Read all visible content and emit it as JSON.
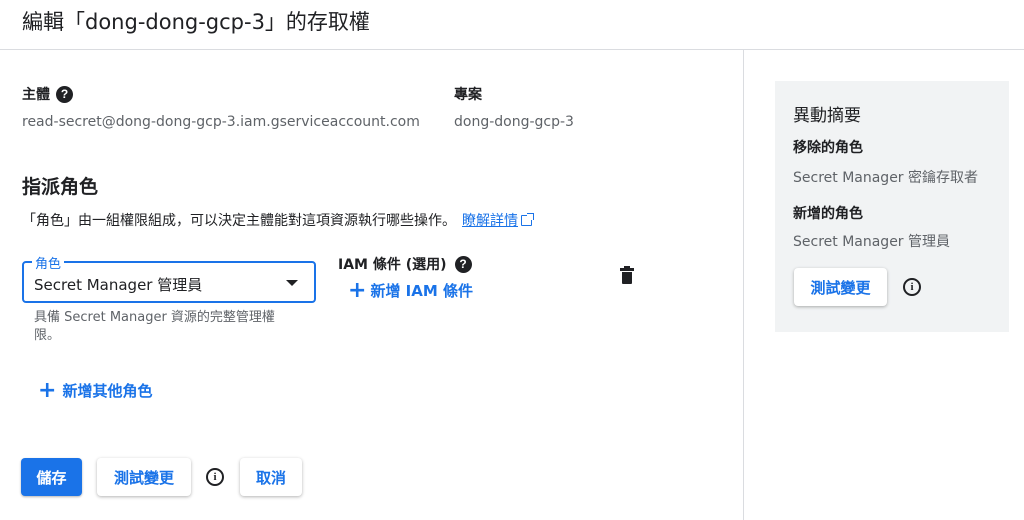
{
  "header": {
    "title": "編輯「dong-dong-gcp-3」的存取權"
  },
  "principal": {
    "label": "主體",
    "help_icon": "question-mark-circle",
    "value": "read-secret@dong-dong-gcp-3.iam.gserviceaccount.com"
  },
  "project": {
    "label": "專案",
    "value": "dong-dong-gcp-3"
  },
  "assign_roles": {
    "title": "指派角色",
    "description": "「角色」由一組權限組成，可以決定主體能對這項資源執行哪些操作。",
    "learn_more": "瞭解詳情",
    "role_field": {
      "label": "角色",
      "value": "Secret Manager 管理員",
      "hint": "具備 Secret Manager 資源的完整管理權限。"
    },
    "iam_condition": {
      "label": "IAM 條件 (選用)",
      "add_label": "新增 IAM 條件"
    },
    "add_role_label": "新增其他角色"
  },
  "actions": {
    "save": "儲存",
    "test_changes": "測試變更",
    "cancel": "取消"
  },
  "summary": {
    "title": "異動摘要",
    "removed_label": "移除的角色",
    "removed_value": "Secret Manager 密鑰存取者",
    "added_label": "新增的角色",
    "added_value": "Secret Manager 管理員",
    "test_changes": "測試變更"
  },
  "colors": {
    "accent": "#1a73e8",
    "panel_bg": "#f1f3f4",
    "muted_text": "#5f6368"
  }
}
